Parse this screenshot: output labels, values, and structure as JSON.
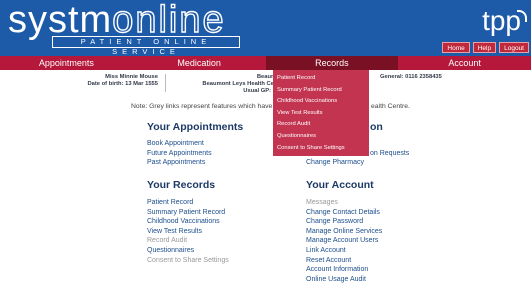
{
  "header": {
    "logo_left": "systm",
    "logo_right": "online",
    "logo_sub": "PATIENT ONLINE SERVICE",
    "tpp": "tpp",
    "buttons": [
      "Home",
      "Help",
      "Logout"
    ]
  },
  "nav": [
    "Appointments",
    "Medication",
    "Records",
    "Account"
  ],
  "patient": {
    "name": "Miss Minnie Mouse",
    "dob": "Date of birth: 13 Mar 1555",
    "practice_line1": "Beaumont Leys",
    "practice_line2": "Beaumont Leys Health Centre, 1 Lit",
    "practice_line3": "Usual GP: Dr Beaum",
    "phone": "General: 0116 2358435"
  },
  "note": "Note: Grey links represent features which have",
  "note_tail": "ealth Centre.",
  "appointments": {
    "title": "Your Appointments",
    "links": [
      "Book Appointment",
      "Future Appointments",
      "Past Appointments"
    ]
  },
  "medication": {
    "title_tail": "on",
    "links": [
      "on Requests",
      "Change Pharmacy"
    ]
  },
  "records": {
    "title": "Your Records",
    "links": [
      {
        "label": "Patient Record",
        "grey": false
      },
      {
        "label": "Summary Patient Record",
        "grey": false
      },
      {
        "label": "Childhood Vaccinations",
        "grey": false
      },
      {
        "label": "View Test Results",
        "grey": false
      },
      {
        "label": "Record Audit",
        "grey": true
      },
      {
        "label": "Questionnaires",
        "grey": false
      },
      {
        "label": "Consent to Share Settings",
        "grey": true
      }
    ]
  },
  "account": {
    "title": "Your Account",
    "links": [
      {
        "label": "Messages",
        "grey": true
      },
      {
        "label": "Change Contact Details",
        "grey": false
      },
      {
        "label": "Change Password",
        "grey": false
      },
      {
        "label": "Manage Online Services",
        "grey": false
      },
      {
        "label": "Manage Account Users",
        "grey": false
      },
      {
        "label": "Link Account",
        "grey": false
      },
      {
        "label": "Reset Account",
        "grey": false
      },
      {
        "label": "Account Information",
        "grey": false
      },
      {
        "label": "Online Usage Audit",
        "grey": false
      }
    ]
  },
  "dropdown": [
    "Patient Record",
    "Summary Patient Record",
    "Childhood Vaccinations",
    "View Test Results",
    "Record Audit",
    "Questionnaires",
    "Consent to Share Settings"
  ],
  "colors": {
    "header_blue": "#1d5aa8",
    "nav_red": "#b5183a",
    "nav_active": "#7a1024",
    "dropdown_red": "#c23450",
    "link_blue": "#1d4e8c",
    "title_navy": "#1d3a66"
  }
}
